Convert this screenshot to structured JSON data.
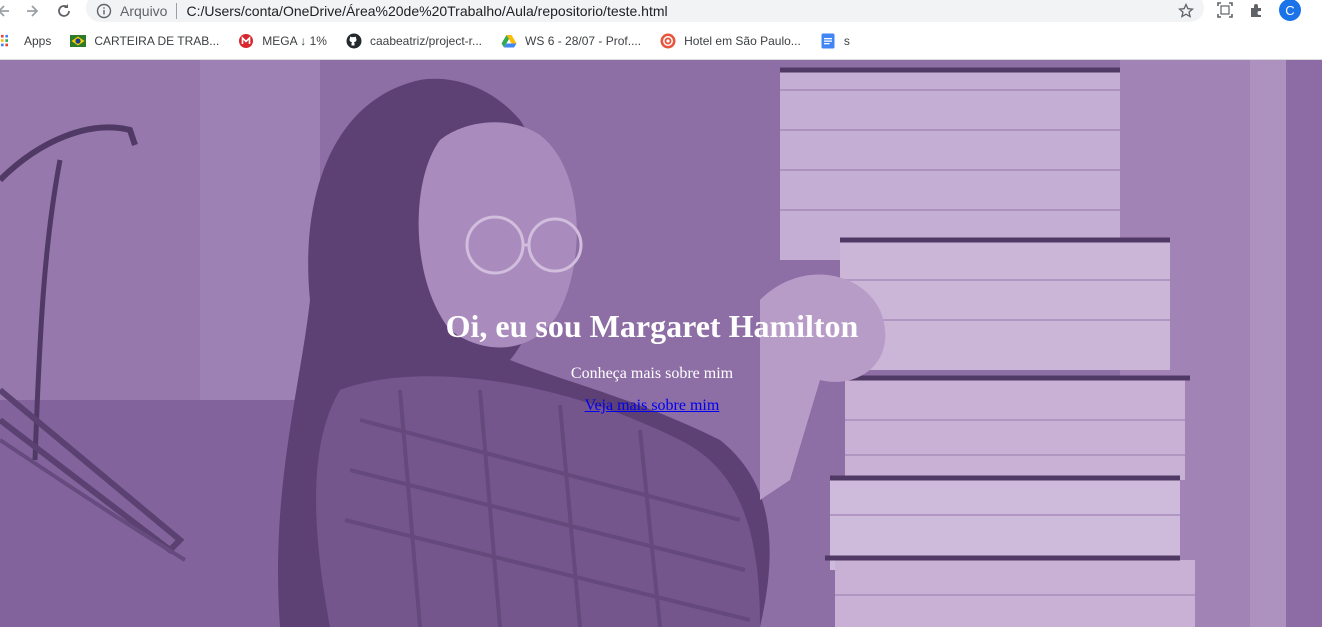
{
  "browser": {
    "scheme_label": "Arquivo",
    "url": "C:/Users/conta/OneDrive/Área%20de%20Trabalho/Aula/repositorio/teste.html",
    "profile_initial": "C",
    "icons": [
      "back-arrow-icon",
      "forward-arrow-icon",
      "reload-icon",
      "info-icon",
      "star-icon",
      "media-router-icon",
      "extensions-icon"
    ]
  },
  "bookmarks": [
    {
      "label": "Apps",
      "icon": "apps-grid-icon"
    },
    {
      "label": "CARTEIRA DE TRAB...",
      "icon": "brazil-flag-icon"
    },
    {
      "label": "MEGA ↓ 1%",
      "icon": "mega-icon"
    },
    {
      "label": "caabeatriz/project-r...",
      "icon": "github-icon"
    },
    {
      "label": "WS 6 - 28/07 - Prof....",
      "icon": "google-drive-icon"
    },
    {
      "label": "Hotel em São Paulo...",
      "icon": "hotel-icon"
    },
    {
      "label": "s",
      "icon": "google-docs-icon"
    }
  ],
  "page": {
    "title": "Oi, eu sou Margaret Hamilton",
    "subtitle": "Conheça mais sobre mim",
    "link_text": "Veja mais sobre mim"
  },
  "colors": {
    "hero_tint": "#7a5c8e",
    "link": "#0000ee",
    "avatar": "#1a73e8"
  }
}
